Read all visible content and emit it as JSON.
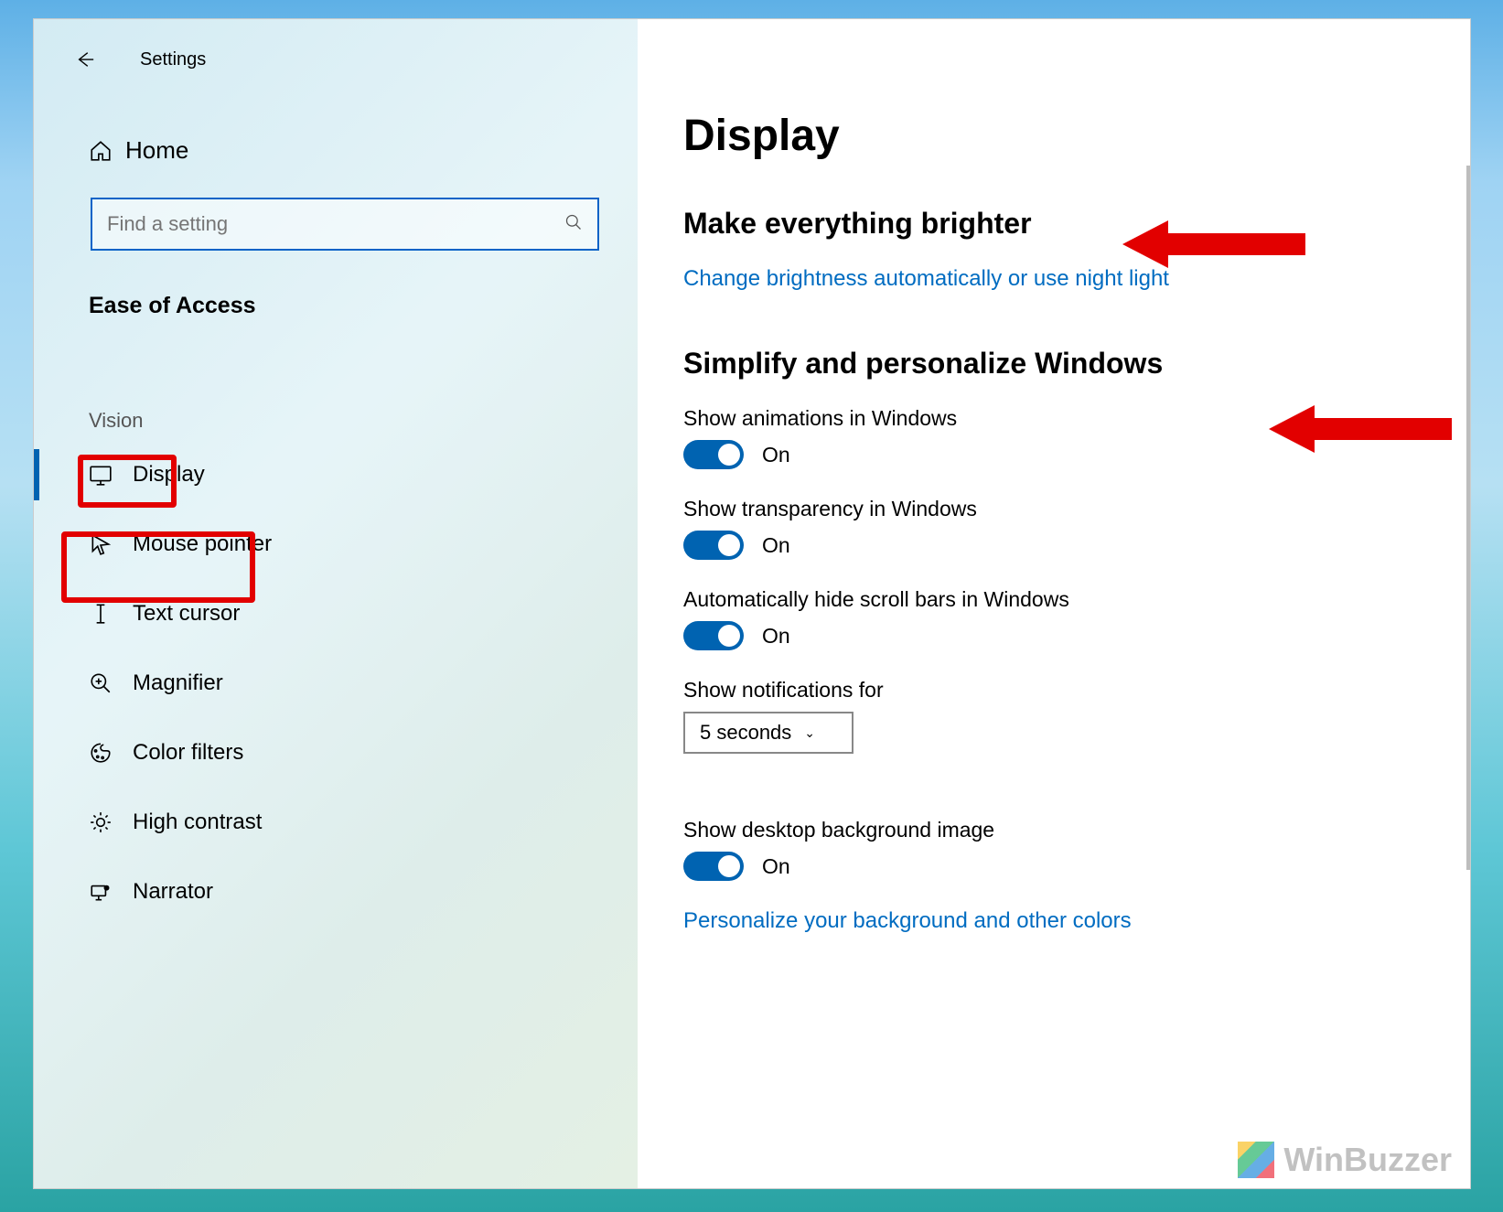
{
  "window": {
    "title": "Settings",
    "controls": {
      "minimize": "—",
      "maximize": "□",
      "close": "✕"
    }
  },
  "sidebar": {
    "home": "Home",
    "search_placeholder": "Find a setting",
    "category": "Ease of Access",
    "group": "Vision",
    "items": [
      {
        "icon": "display-icon",
        "label": "Display",
        "active": true
      },
      {
        "icon": "mouse-pointer-icon",
        "label": "Mouse pointer",
        "active": false
      },
      {
        "icon": "text-cursor-icon",
        "label": "Text cursor",
        "active": false
      },
      {
        "icon": "magnifier-icon",
        "label": "Magnifier",
        "active": false
      },
      {
        "icon": "palette-icon",
        "label": "Color filters",
        "active": false
      },
      {
        "icon": "sun-icon",
        "label": "High contrast",
        "active": false
      },
      {
        "icon": "narrator-icon",
        "label": "Narrator",
        "active": false
      }
    ]
  },
  "main": {
    "title": "Display",
    "section1": {
      "heading": "Make everything brighter",
      "link": "Change brightness automatically or use night light"
    },
    "section2": {
      "heading": "Simplify and personalize Windows",
      "settings": [
        {
          "label": "Show animations in Windows",
          "state": "On"
        },
        {
          "label": "Show transparency in Windows",
          "state": "On"
        },
        {
          "label": "Automatically hide scroll bars in Windows",
          "state": "On"
        }
      ],
      "notifications": {
        "label": "Show notifications for",
        "value": "5 seconds"
      },
      "bgimage": {
        "label": "Show desktop background image",
        "state": "On"
      },
      "link": "Personalize your background and other colors"
    }
  },
  "watermark": "WinBuzzer"
}
